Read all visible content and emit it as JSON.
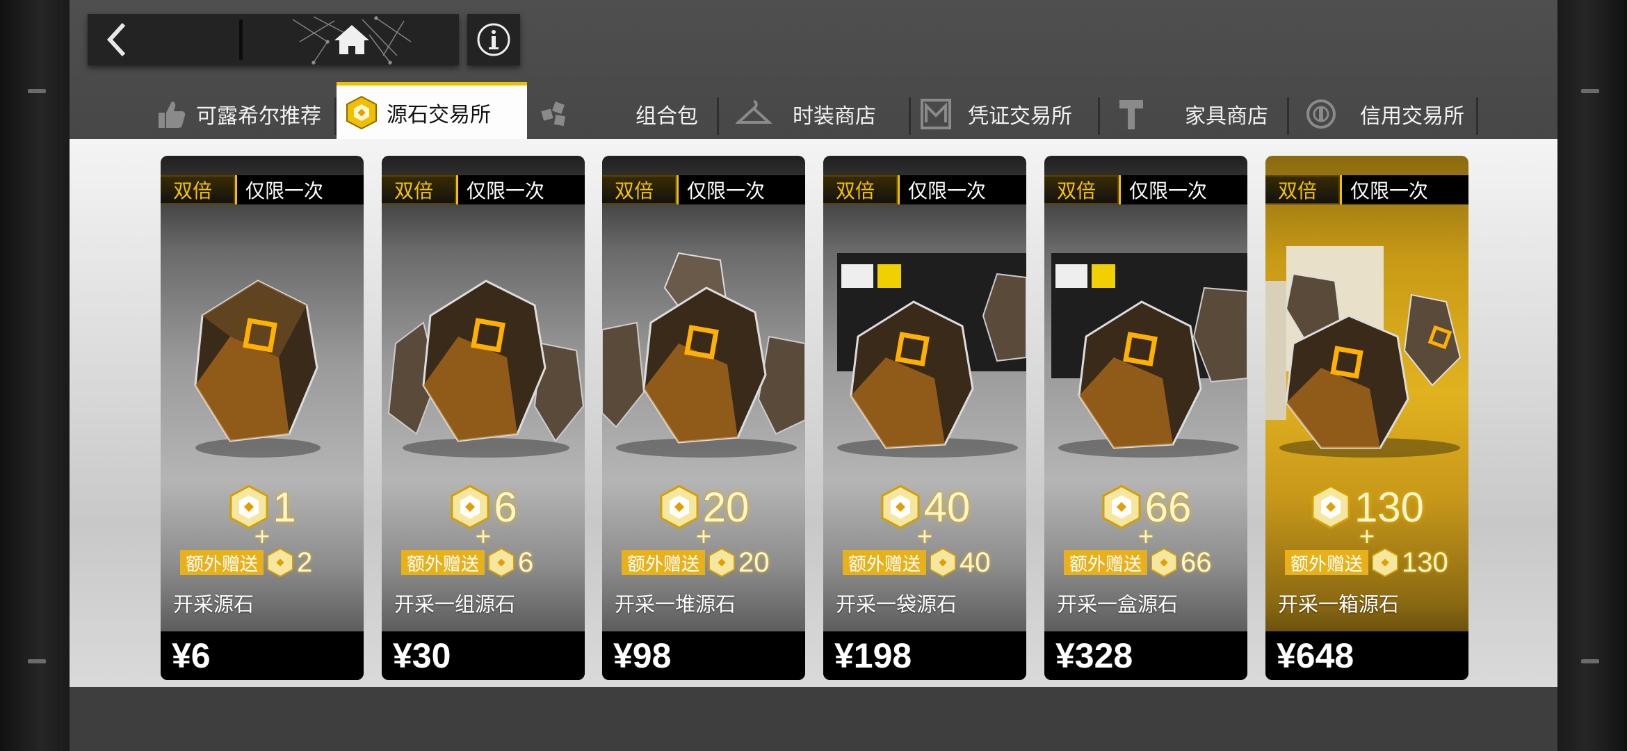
{
  "nav": {
    "back_icon": "chevron-left-icon",
    "home_icon": "home-icon",
    "info_icon": "info-icon"
  },
  "tabs": [
    {
      "label": "可露希尔推荐",
      "icon": "thumbs-up-icon",
      "active": false
    },
    {
      "label": "源石交易所",
      "icon": "originite-icon",
      "active": true
    },
    {
      "label": "组合包",
      "icon": "bundle-cubes-icon",
      "active": false
    },
    {
      "label": "时装商店",
      "icon": "hanger-icon",
      "active": false
    },
    {
      "label": "凭证交易所",
      "icon": "voucher-icon",
      "active": false
    },
    {
      "label": "家具商店",
      "icon": "hammer-icon",
      "active": false
    },
    {
      "label": "信用交易所",
      "icon": "credit-icon",
      "active": false
    }
  ],
  "products": [
    {
      "double_label": "双倍",
      "limit_label": "仅限一次",
      "quantity": "1",
      "plus": "+",
      "bonus_label": "额外赠送",
      "bonus_quantity": "2",
      "name": "开采源石",
      "price": "¥6"
    },
    {
      "double_label": "双倍",
      "limit_label": "仅限一次",
      "quantity": "6",
      "plus": "+",
      "bonus_label": "额外赠送",
      "bonus_quantity": "6",
      "name": "开采一组源石",
      "price": "¥30"
    },
    {
      "double_label": "双倍",
      "limit_label": "仅限一次",
      "quantity": "20",
      "plus": "+",
      "bonus_label": "额外赠送",
      "bonus_quantity": "20",
      "name": "开采一堆源石",
      "price": "¥98"
    },
    {
      "double_label": "双倍",
      "limit_label": "仅限一次",
      "quantity": "40",
      "plus": "+",
      "bonus_label": "额外赠送",
      "bonus_quantity": "40",
      "name": "开采一袋源石",
      "price": "¥198"
    },
    {
      "double_label": "双倍",
      "limit_label": "仅限一次",
      "quantity": "66",
      "plus": "+",
      "bonus_label": "额外赠送",
      "bonus_quantity": "66",
      "name": "开采一盒源石",
      "price": "¥328"
    },
    {
      "double_label": "双倍",
      "limit_label": "仅限一次",
      "quantity": "130",
      "plus": "+",
      "bonus_label": "额外赠送",
      "bonus_quantity": "130",
      "name": "开采一箱源石",
      "price": "¥648"
    }
  ],
  "colors": {
    "accent_gold": "#f0c000",
    "bonus_bg": "#e8b11a",
    "tab_active_bg": "#fdfdfd"
  }
}
